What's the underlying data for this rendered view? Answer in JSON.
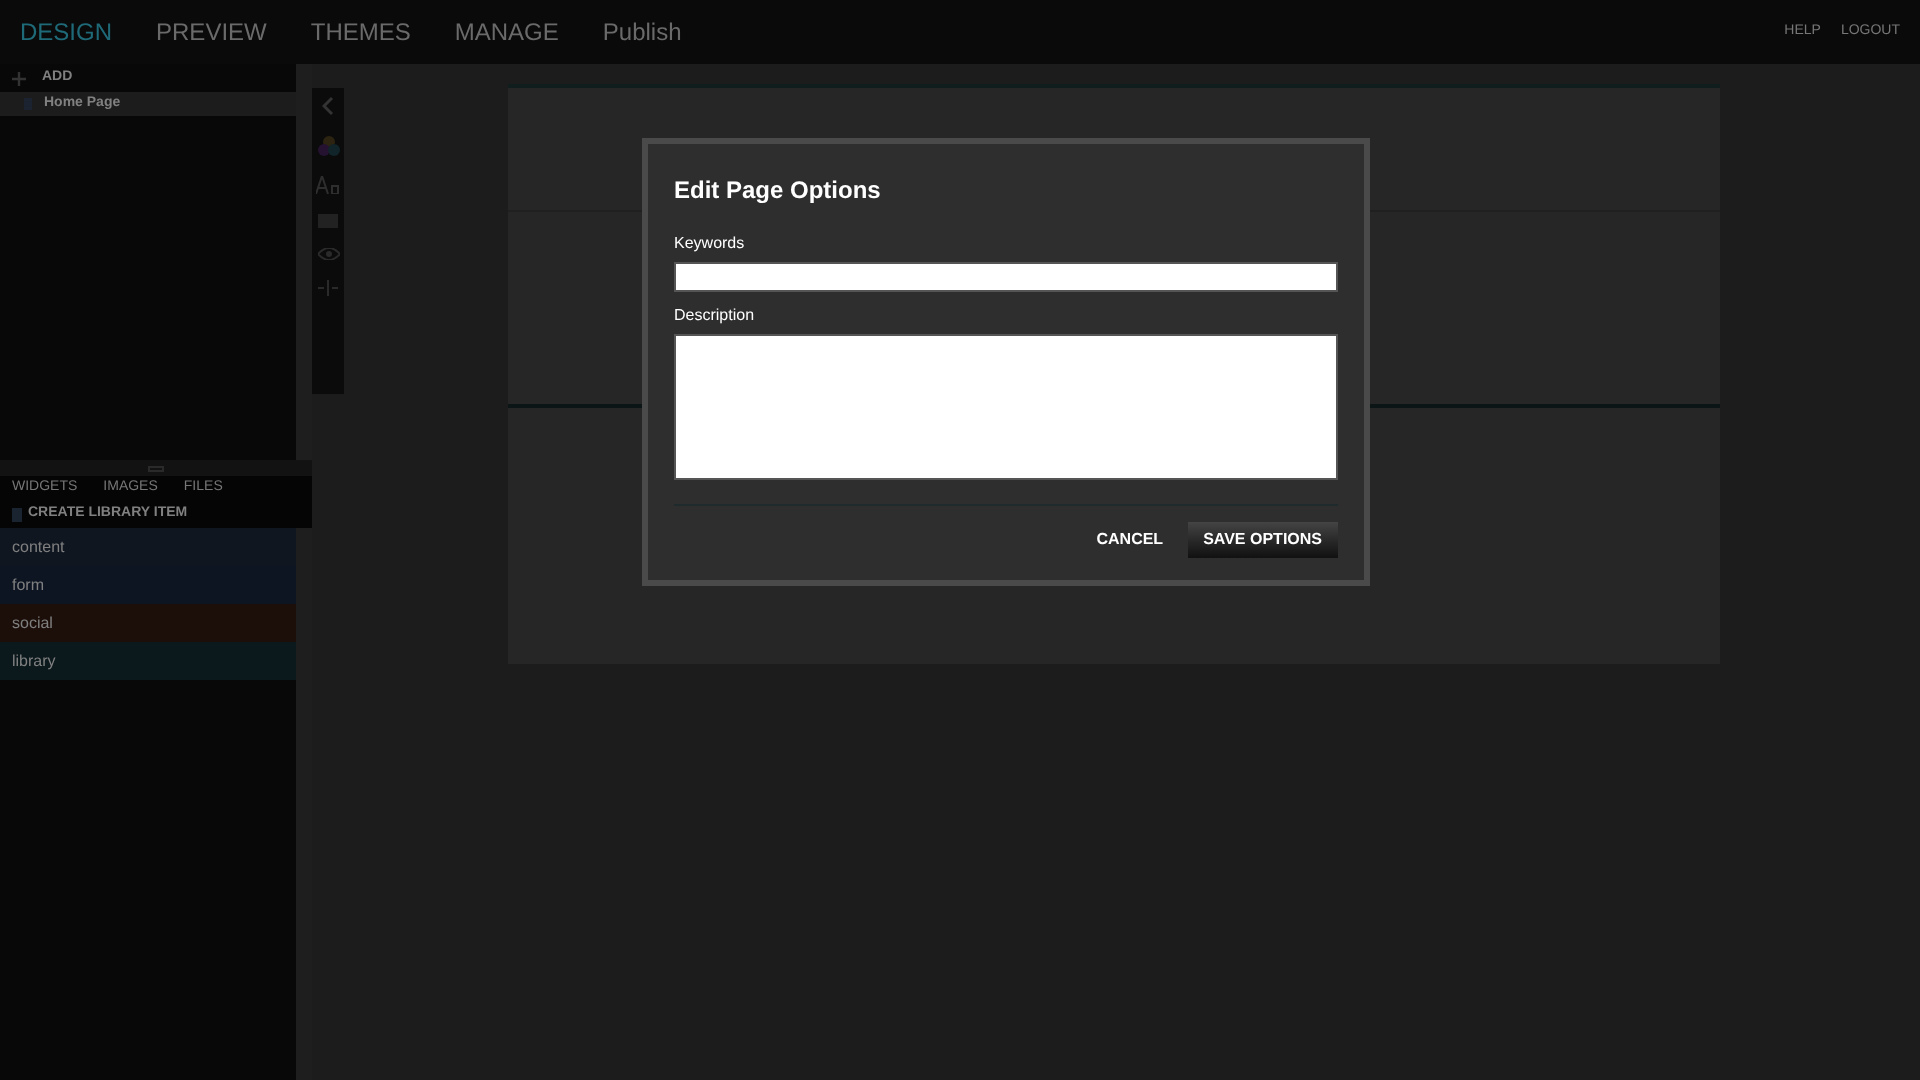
{
  "nav": {
    "tabs": [
      {
        "label": "DESIGN",
        "selected": true
      },
      {
        "label": "PREVIEW",
        "selected": false
      },
      {
        "label": "THEMES",
        "selected": false
      },
      {
        "label": "MANAGE",
        "selected": false
      },
      {
        "label": "Publish",
        "selected": false
      }
    ],
    "links": [
      "HELP",
      "LOGOUT"
    ]
  },
  "pages_panel": {
    "add_label": "ADD",
    "pages": [
      {
        "label": "Home Page",
        "selected": true
      }
    ]
  },
  "library_panel": {
    "tabs": [
      {
        "label": "WIDGETS",
        "selected": false
      },
      {
        "label": "IMAGES",
        "selected": false
      },
      {
        "label": "FILES",
        "selected": false
      }
    ],
    "create_label": "CREATE LIBRARY ITEM",
    "categories": [
      {
        "label": "content",
        "color": "#0f1620"
      },
      {
        "label": "form",
        "color": "#0d1422"
      },
      {
        "label": "social",
        "color": "#1c0f0a"
      },
      {
        "label": "library",
        "color": "#0b181c"
      }
    ]
  },
  "dialog": {
    "title": "Edit Page Options",
    "fields": [
      {
        "kind": "line",
        "label": "Keywords"
      },
      {
        "kind": "area",
        "label": "Description"
      }
    ],
    "cancel": "CANCEL",
    "save": "SAVE OPTIONS"
  }
}
